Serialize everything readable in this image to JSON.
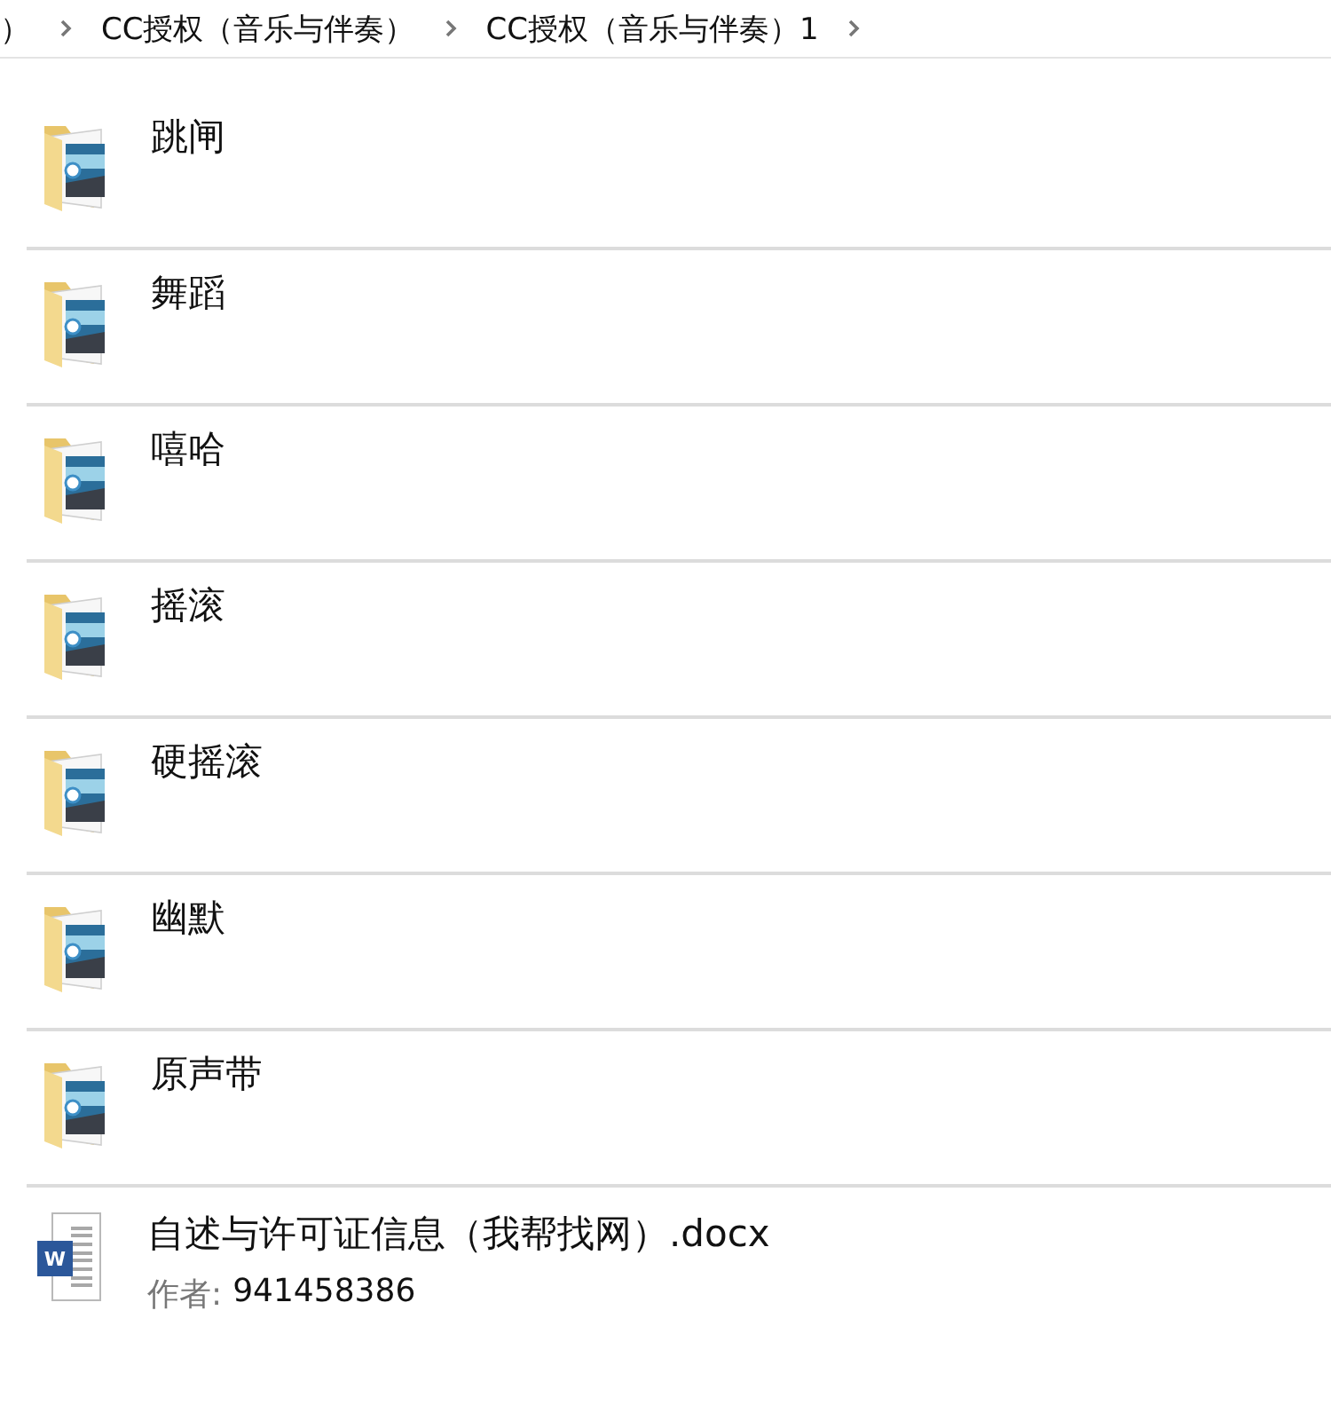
{
  "breadcrumb": [
    {
      "label": "）"
    },
    {
      "label": "CC授权（音乐与伴奏）"
    },
    {
      "label": "CC授权（音乐与伴奏）1"
    }
  ],
  "items": [
    {
      "kind": "folder",
      "name": "跳闸"
    },
    {
      "kind": "folder",
      "name": "舞蹈"
    },
    {
      "kind": "folder",
      "name": "嘻哈"
    },
    {
      "kind": "folder",
      "name": "摇滚"
    },
    {
      "kind": "folder",
      "name": "硬摇滚"
    },
    {
      "kind": "folder",
      "name": "幽默"
    },
    {
      "kind": "folder",
      "name": "原声带"
    },
    {
      "kind": "document",
      "name": "自述与许可证信息（我帮找网）.docx",
      "icon_letter": "W",
      "author_label": "作者:",
      "author": "941458386"
    }
  ]
}
